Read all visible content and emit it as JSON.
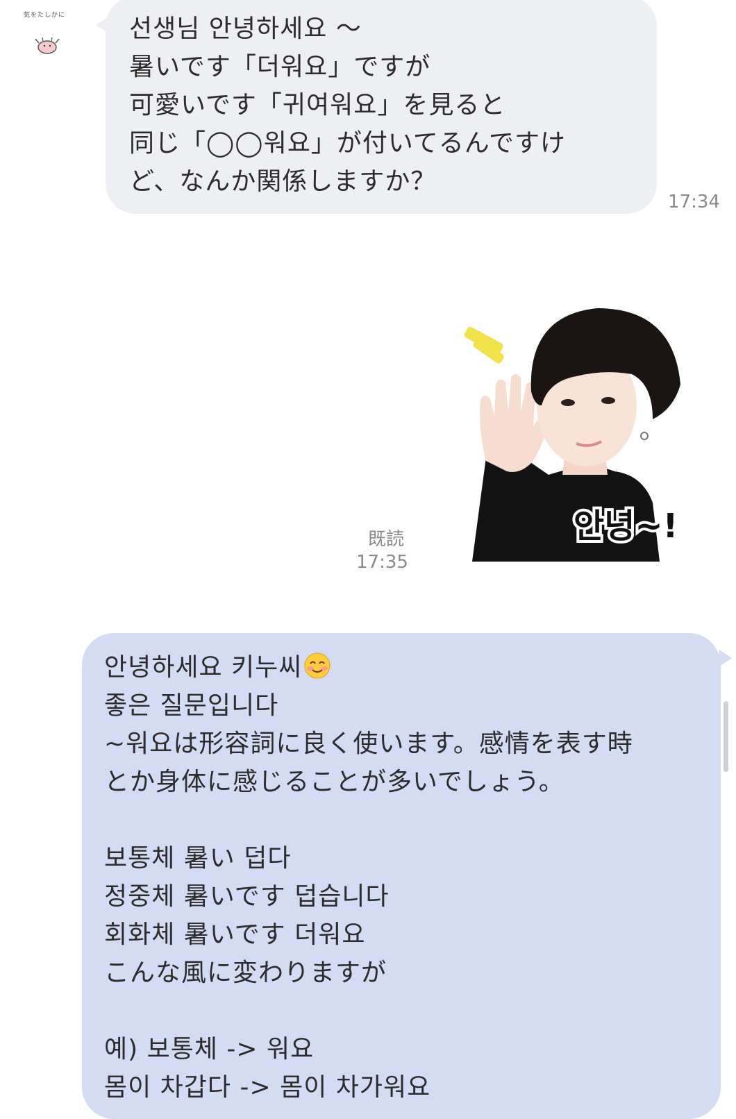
{
  "chat": {
    "incoming": {
      "avatar_caption": "気をたしかに",
      "lines": [
        "선생님 안녕하세요 〜",
        "暑いです「더워요」ですが",
        "可愛いです「귀여워요」を見ると",
        "同じ「◯◯워요」が付いてるんですけ",
        "ど、なんか関係しますか？"
      ],
      "time": "17:34"
    },
    "sticker": {
      "caption": "안녕~!",
      "read_label": "既読",
      "time": "17:35"
    },
    "outgoing": {
      "lines": [
        "안녕하세요 키누씨",
        "좋은 질문입니다",
        "~워요は形容詞に良く使います。感情を表す時",
        "とか身体に感じることが多いでしょう。",
        "",
        "보통체 暑い 덥다",
        "정중체 暑いです 덥습니다",
        "회화체 暑いです 더워요",
        "こんな風に変わりますが",
        "",
        "예) 보통체 -> 워요",
        "몸이 차갑다 -> 몸이 차가워요"
      ],
      "emoji": "smiling-face-icon"
    }
  },
  "colors": {
    "incoming_bubble": "#eeeff2",
    "outgoing_bubble": "#d4dcf3",
    "meta_text": "#8a8a8a"
  }
}
